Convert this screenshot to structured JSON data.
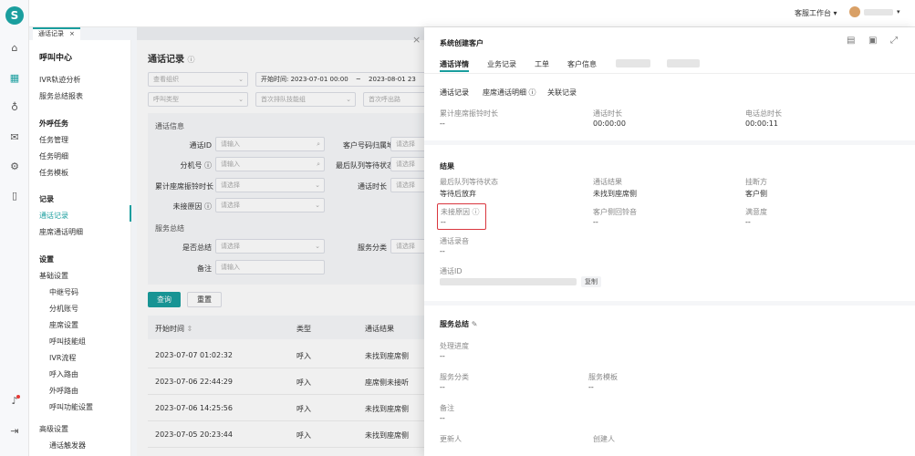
{
  "header": {
    "workspace_label": "客服工作台"
  },
  "rail": {
    "logo": "S"
  },
  "page_tab": {
    "label": "通话记录",
    "close": "×"
  },
  "nav": {
    "title": "呼叫中心",
    "items": [
      "IVR轨迹分析",
      "服务总结报表"
    ],
    "outbound": {
      "title": "外呼任务",
      "items": [
        "任务管理",
        "任务明细",
        "任务模板"
      ]
    },
    "records": {
      "title": "记录",
      "items": [
        "通话记录",
        "座席通话明细"
      ]
    },
    "settings": {
      "title": "设置",
      "basic": "基础设置",
      "basic_items": [
        "中继号码",
        "分机账号",
        "座席设置",
        "呼叫技能组",
        "IVR流程",
        "呼入路由",
        "外呼路由",
        "呼叫功能设置"
      ],
      "advanced": "高级设置",
      "advanced_items": [
        "通话触发器"
      ]
    }
  },
  "main": {
    "title": "通话记录",
    "filters": {
      "org_placeholder": "查看组织",
      "start_label": "开始时间:",
      "start_value": "2023-07-01 00:00",
      "range_sep": "~",
      "end_value": "2023-08-01 23",
      "call_type_placeholder": "呼叫类型",
      "first_queue_placeholder": "首次排队技能组",
      "first_ivr_placeholder": "首次呼出路"
    },
    "advanced": {
      "call_info_title": "通话信息",
      "call_id_label": "通话ID",
      "call_id_ph": "请输入",
      "ext_label": "分机号",
      "ext_ph": "请输入",
      "duration_label": "累计座席振铃时长",
      "duration_ph": "请选择",
      "unanswered_label": "未接原因",
      "unanswered_ph": "请选择",
      "caller_area_label": "客户号码归属地",
      "caller_area_ph": "请选择",
      "last_queue_label": "最后队列等待状态",
      "last_queue_ph": "请选择",
      "call_duration_label": "通话时长",
      "call_duration_ph": "请选择",
      "summary_title": "服务总结",
      "summarized_label": "是否总结",
      "summarized_ph": "请选择",
      "category_label": "服务分类",
      "category_ph": "请选择",
      "remark_label": "备注",
      "remark_ph": "请输入"
    },
    "search_btn": "查询",
    "reset_btn": "重置",
    "table": {
      "headers": [
        "开始时间",
        "类型",
        "通话结果"
      ],
      "rows": [
        [
          "2023-07-07 01:02:32",
          "呼入",
          "未找到座席侧"
        ],
        [
          "2023-07-06 22:44:29",
          "呼入",
          "座席侧未接听"
        ],
        [
          "2023-07-06 14:25:56",
          "呼入",
          "未找到座席侧"
        ],
        [
          "2023-07-05 20:23:44",
          "呼入",
          "未找到座席侧"
        ]
      ]
    }
  },
  "drawer": {
    "close": "×",
    "title": "系统创建客户",
    "tabs": [
      "通话详情",
      "业务记录",
      "工单",
      "客户信息"
    ],
    "subtabs": [
      "通话记录",
      "座席通话明细",
      "关联记录"
    ],
    "stats": [
      {
        "label": "累计座席振铃时长",
        "value": "--"
      },
      {
        "label": "通话时长",
        "value": "00:00:00"
      },
      {
        "label": "电话总时长",
        "value": "00:00:11"
      }
    ],
    "result_title": "结果",
    "results": [
      {
        "label": "最后队列等待状态",
        "value": "等待后放弃"
      },
      {
        "label": "通话结果",
        "value": "未找到座席侧"
      },
      {
        "label": "挂断方",
        "value": "客户侧"
      },
      {
        "label": "未接原因",
        "value": "--"
      },
      {
        "label": "客户侧回铃音",
        "value": "--"
      },
      {
        "label": "满意度",
        "value": "--"
      }
    ],
    "recording_label": "通话录音",
    "recording_value": "--",
    "callid_label": "通话ID",
    "copy_label": "复制",
    "summary_title": "服务总结",
    "progress_label": "处理进度",
    "progress_value": "--",
    "category_label": "服务分类",
    "category_value": "--",
    "template_label": "服务模板",
    "template_value": "--",
    "remark_label": "备注",
    "remark_value": "--",
    "updater_label": "更新人",
    "creator_label": "创建人"
  },
  "colors": {
    "accent": "#1a9e9e",
    "highlight": "#d9363e"
  }
}
